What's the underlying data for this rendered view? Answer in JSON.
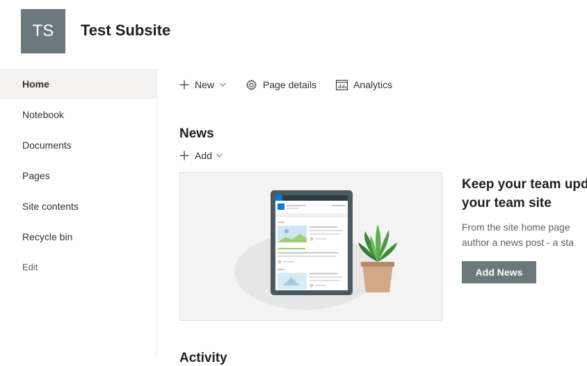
{
  "site": {
    "logo_initials": "TS",
    "title": "Test Subsite"
  },
  "nav": {
    "items": [
      {
        "label": "Home",
        "selected": true
      },
      {
        "label": "Notebook"
      },
      {
        "label": "Documents"
      },
      {
        "label": "Pages"
      },
      {
        "label": "Site contents"
      },
      {
        "label": "Recycle bin"
      }
    ],
    "edit_label": "Edit"
  },
  "command_bar": {
    "new_label": "New",
    "page_details_label": "Page details",
    "analytics_label": "Analytics"
  },
  "news": {
    "title": "News",
    "add_label": "Add",
    "promo_heading_line1": "Keep your team upd",
    "promo_heading_line2": "your team site",
    "promo_body_line1": "From the site home page",
    "promo_body_line2": "author a news post - a sta",
    "add_news_button": "Add News"
  },
  "activity": {
    "title": "Activity"
  },
  "colors": {
    "accent": "#69797e",
    "nav_selected_bg": "#f3f2f1",
    "text": "#323130"
  }
}
